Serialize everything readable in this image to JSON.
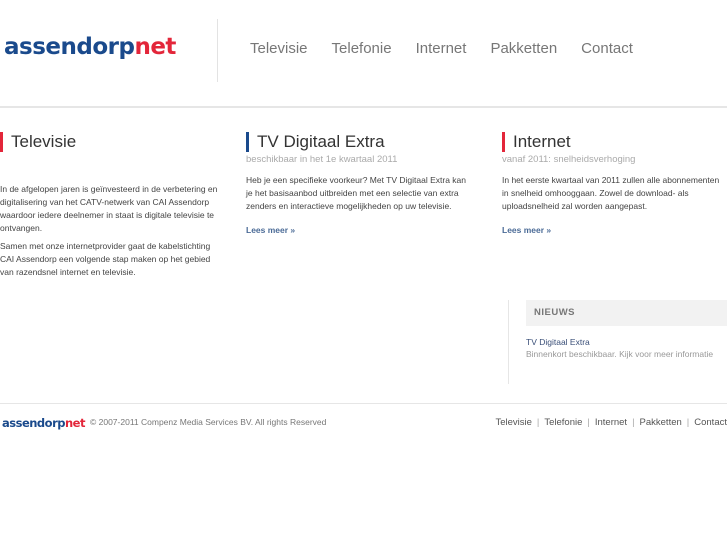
{
  "logo": {
    "part1": "assendorp",
    "part2": "net"
  },
  "nav": [
    "Televisie",
    "Telefonie",
    "Internet",
    "Pakketten",
    "Contact"
  ],
  "columns": [
    {
      "title": "Televisie",
      "subtitle": "",
      "paragraphs": [
        "In de afgelopen jaren is geïnvesteerd in de verbetering en digitalisering van het CATV-netwerk van CAI Assendorp waardoor iedere deelnemer in staat is digitale televisie te ontvangen.",
        "Samen met onze internetprovider gaat de kabelstichting CAI Assendorp een volgende stap maken op het gebied van razendsnel internet en televisie."
      ]
    },
    {
      "title": "TV Digitaal Extra",
      "subtitle": "beschikbaar in het 1e kwartaal 2011",
      "paragraphs": [
        "Heb je een specifieke voorkeur? Met TV Digitaal Extra kan je het basisaanbod uitbreiden met een selectie van extra zenders en interactieve mogelijkheden op uw televisie."
      ],
      "more": "Lees meer »"
    },
    {
      "title": "Internet",
      "subtitle": "vanaf 2011: snelheidsverhoging",
      "paragraphs": [
        "In het eerste kwartaal van 2011 zullen alle abonnementen in snelheid omhooggaan. Zowel de download- als uploadsnelheid zal worden aangepast."
      ],
      "more": "Lees meer »"
    }
  ],
  "news": {
    "heading": "NIEUWS",
    "item_title": "TV Digitaal Extra",
    "item_desc": "Binnenkort beschikbaar. Kijk voor meer informatie"
  },
  "footer": {
    "copyright": "© 2007-2011 Compenz Media Services BV. All rights Reserved",
    "sep": "|"
  },
  "colors": {
    "blue": "#1a4a8c",
    "red": "#e3263a"
  }
}
